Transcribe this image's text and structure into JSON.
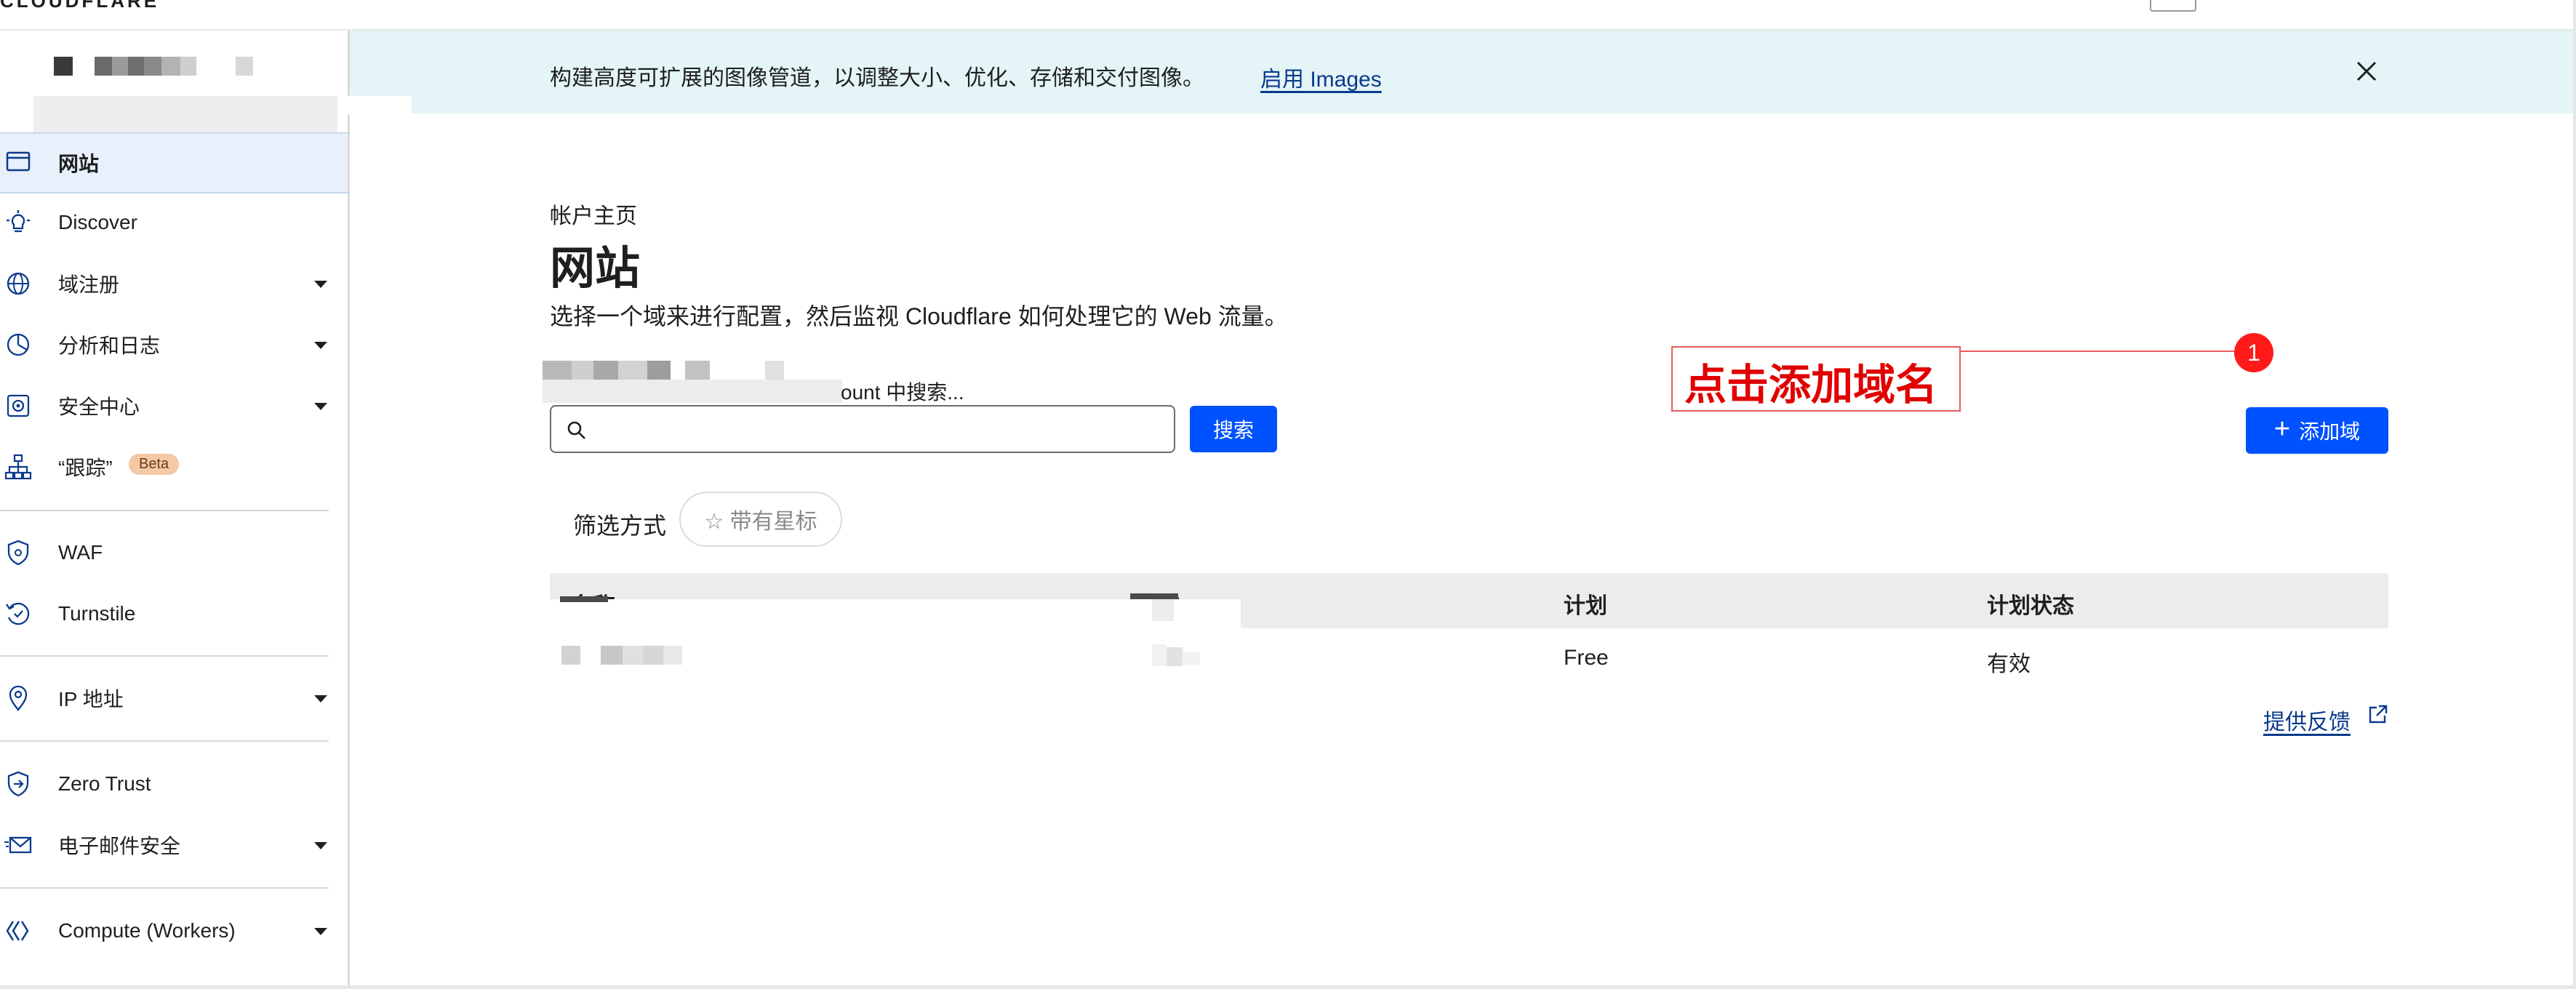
{
  "brand": {
    "logo_text": "CLOUDFLARE"
  },
  "banner": {
    "text": "构建高度可扩展的图像管道，以调整大小、优化、存储和交付图像。",
    "link_label": "启用 Images"
  },
  "sidebar": {
    "items": [
      {
        "label": "网站",
        "icon": "browser-window-icon",
        "active": true
      },
      {
        "label": "Discover",
        "icon": "lightbulb-icon"
      },
      {
        "label": "域注册",
        "icon": "globe-icon",
        "expandable": true
      },
      {
        "label": "分析和日志",
        "icon": "pie-chart-icon",
        "expandable": true
      },
      {
        "label": "安全中心",
        "icon": "security-center-icon",
        "expandable": true
      },
      {
        "label": "“跟踪”",
        "icon": "sitemap-icon",
        "badge": "Beta"
      },
      {
        "label": "WAF",
        "icon": "shield-icon"
      },
      {
        "label": "Turnstile",
        "icon": "turnstile-icon"
      },
      {
        "label": "IP 地址",
        "icon": "location-pin-icon",
        "expandable": true
      },
      {
        "label": "Zero Trust",
        "icon": "zero-trust-icon"
      },
      {
        "label": "电子邮件安全",
        "icon": "envelope-icon",
        "expandable": true
      },
      {
        "label": "Compute (Workers)",
        "icon": "workers-icon",
        "expandable": true
      }
    ]
  },
  "main": {
    "breadcrumb": "帐户主页",
    "title": "网站",
    "description": "选择一个域来进行配置，然后监视 Cloudflare 如何处理它的 Web 流量。",
    "search": {
      "label": "ount 中搜索...",
      "placeholder": "",
      "button_label": "搜索"
    },
    "add_domain_button": "添加域",
    "filter": {
      "label": "筛选方式",
      "starred_label": "☆ 带有星标"
    },
    "table": {
      "columns": [
        "名称",
        "状态",
        "计划",
        "计划状态"
      ],
      "rows": [
        {
          "name": "",
          "status": "",
          "plan": "Free",
          "plan_status": "有效"
        }
      ]
    },
    "feedback_link": "提供反馈"
  },
  "annotation": {
    "text": "点击添加域名",
    "step_number": "1",
    "color": "#e10000"
  },
  "colors": {
    "accent": "#0051ff",
    "banner_bg": "#e4f4f7",
    "active_nav_bg": "#e8f0fb",
    "link": "#0a3a8c"
  }
}
